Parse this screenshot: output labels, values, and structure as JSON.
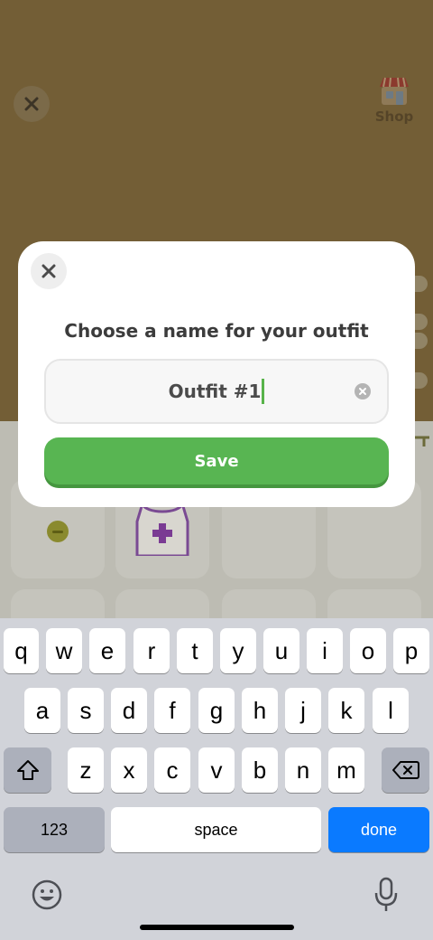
{
  "background": {
    "shop_label": "Shop"
  },
  "dialog": {
    "title": "Choose a name for your outfit",
    "name_value": "Outfit #1",
    "save_label": "Save"
  },
  "keyboard": {
    "row1": [
      "q",
      "w",
      "e",
      "r",
      "t",
      "y",
      "u",
      "i",
      "o",
      "p"
    ],
    "row2": [
      "a",
      "s",
      "d",
      "f",
      "g",
      "h",
      "j",
      "k",
      "l"
    ],
    "row3": [
      "z",
      "x",
      "c",
      "v",
      "b",
      "n",
      "m"
    ],
    "numbers_label": "123",
    "space_label": "space",
    "done_label": "done"
  },
  "colors": {
    "accent_green": "#58b552",
    "done_blue": "#0a7aff",
    "backdrop_brown": "#735e36"
  }
}
